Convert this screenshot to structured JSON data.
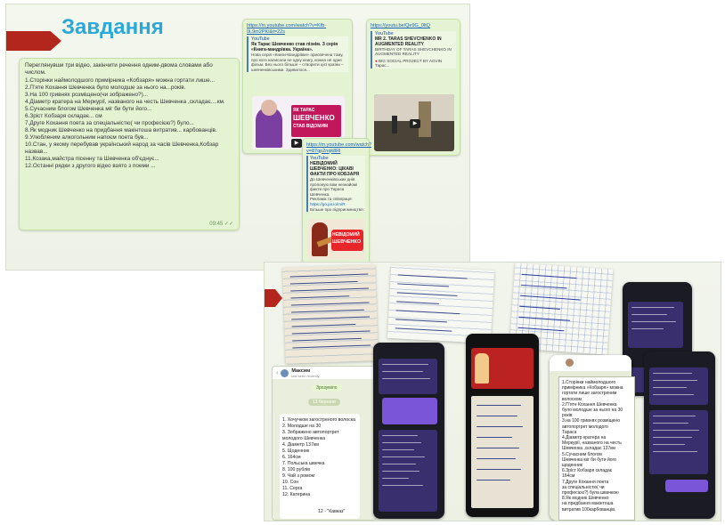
{
  "slide1": {
    "title": "Завдання",
    "task": {
      "intro": "Переглянувши три відео, закінчити речення одним-двома словами або числом.",
      "questions": [
        "1.Сторінки наймолодшого примірника «Кобзаря» можна гортати лише...",
        "2.Пʼяте Кохання Шевченка було молодше за нього на...років.",
        "3.На 100 гривнях розміщено(чи зображено?)...",
        "4.Діаметр кратера на Меркурії, названого на честь Шевченка ,складає....км.",
        "5.Сучасним блогом Шевченка міг би бути його...",
        "6.Зріст Кобзаря складає... см",
        "7.Друге Кохання поета за спеціальністю( чи професією?) було...",
        "8.Як модник Шевченко на придбання макінтоша витратив... карбованців.",
        "9.Улюбленим алкогольним напоєм поета був...",
        "10.Стан, у якому перебував український народ за часів Шевченка,Кобзар назвав...",
        "11.Козака,майстра пісенну та Шевченка об'єднує...",
        "12.Останні рядки з другого відео взято з поеми ..."
      ],
      "time": "09:45"
    },
    "video1": {
      "link": "https://m.youtube.com/watch?v=Kfb-0L9m2PKI&t=22s",
      "source": "YouTube",
      "title": "Як Тарас Шевченко став пізнім. З серія «Книга-мандрівка. Україна».",
      "desc": "Нова серія «Книги-Мандрівки» присвячена тому, про кого написали не одну книгу, кожна не одне фільм. Без нього більше – створити цієї країни – шевченківськими. Здивилося...",
      "thumb_text_1": "ЯК ТАРАС",
      "thumb_text_2": "ШЕВЧЕНКО",
      "thumb_text_3": "СТАВ ВІДОМИМ"
    },
    "video2": {
      "link": "https://youtu.be/Qe9G_0ltQ",
      "source": "YouTube",
      "title": "MR 2. TARAS SHEVCHENKO IN AUGMENTED REALITY",
      "desc": "BIRTHDAY OF TARAS SHEVCHENKO IN AUGMENTED REALITY",
      "sub": "BIG SOCIAL PROJECT BY AGVIN",
      "caption": "Тарас..."
    },
    "video3": {
      "link": "https://m.youtube.com/watch?v=87qp2nqk8Rl",
      "source": "YouTube",
      "title": "НЕВІДОМИЙ ШЕВЧЕНКО: ЦІКАВІ ФАКТИ ПРО КОБЗАРЯ",
      "desc": "До Шевченківських днів пропоную вам незнайомі факти про Тараса Шевченка.",
      "extra": "Реклама та співпраця:",
      "extra_link": "https://go.jar.io/m/R",
      "extra2": "Більше про підприємництво:",
      "thumb_text_1": "НЕВІДОМИЙ",
      "thumb_text_2": "ШЕВЧЕНКО"
    }
  },
  "slide2": {
    "chat_name": "Максим",
    "chat_status": "last seen recently",
    "pill_top": "Зрозуміло",
    "pill_date": "13 березня",
    "answers": [
      "1. Хочучком загостреного волоска",
      "2. Молодше на 30",
      "3. Зображено автопортрет молодого Шевченка",
      "4. Діаметр 137км",
      "5. Щоденник",
      "6. 164см",
      "7. Польська швечка",
      "8. 100 рублів",
      "9. Чай з ромом",
      "10. Сон",
      "11. Серга",
      "12. Катерина"
    ],
    "reply": "12 - \"Кавказ\"",
    "doc_answers": [
      "1.Сторінки наймолодшого",
      "примірника «Кобзаря» можна",
      "гортати лише загостреним",
      "волоском",
      "2.Пʼяте Кохання Шевченка",
      "було молодше за нього на 30",
      "років",
      "3.на 100 гривнях розміщено",
      "автопортрет молодого",
      "Тараса",
      "4.Діаметр кратера на",
      "Меркурії, названого на честь",
      "Шевченка ,складає 137км",
      "5.Сучасним блогом",
      "Шевченка міг би бути його",
      "щоденник",
      "6.Зріст Кобзаря складає",
      "164см",
      "7.Друге Кохання поета",
      "за спеціальністю( чи",
      "професією?) була швачкою",
      "8.Як модник Шевченко",
      "на придбання макінтоша",
      "витратив 100карбованців."
    ],
    "colors": {
      "accent_red": "#b3261e",
      "title_blue": "#2aa8d8",
      "chat_green": "#e4f3d2",
      "telegram_purple": "#7a55d8"
    }
  }
}
